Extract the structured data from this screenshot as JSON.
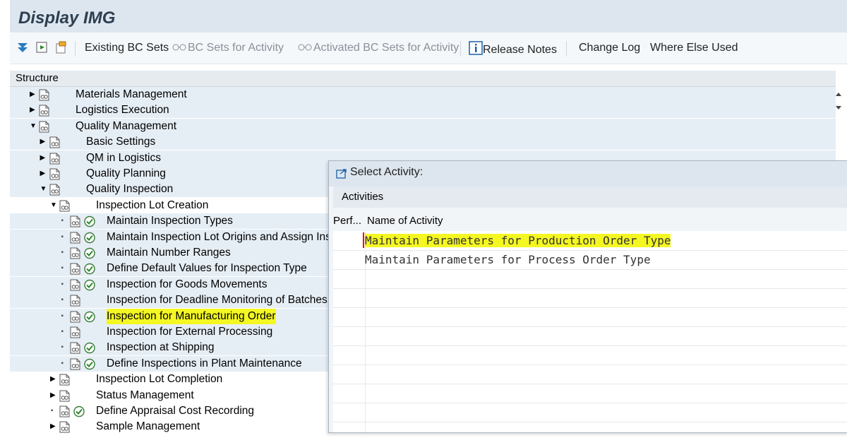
{
  "window": {
    "title": "Display IMG"
  },
  "toolbar": {
    "existing_bc_sets": "Existing BC Sets",
    "bc_sets_for_activity": "BC Sets for Activity",
    "activated_bc_sets": "Activated BC Sets for Activity",
    "release_notes": "Release Notes",
    "change_log": "Change Log",
    "where_else_used": "Where Else Used"
  },
  "structure": {
    "header": "Structure",
    "items": [
      {
        "label": "Materials Management"
      },
      {
        "label": "Logistics Execution"
      },
      {
        "label": "Quality Management"
      },
      {
        "label": "Basic Settings"
      },
      {
        "label": "QM in Logistics"
      },
      {
        "label": "Quality Planning"
      },
      {
        "label": "Quality Inspection"
      },
      {
        "label": "Inspection Lot Creation"
      },
      {
        "label": "Maintain Inspection Types"
      },
      {
        "label": "Maintain Inspection Lot Origins and Assign Ins"
      },
      {
        "label": "Maintain Number Ranges"
      },
      {
        "label": "Define Default Values for Inspection Type"
      },
      {
        "label": "Inspection for Goods Movements"
      },
      {
        "label": "Inspection for Deadline Monitoring of Batches"
      },
      {
        "label": "Inspection for Manufacturing Order"
      },
      {
        "label": "Inspection for External Processing"
      },
      {
        "label": "Inspection at Shipping"
      },
      {
        "label": "Define Inspections in Plant Maintenance"
      },
      {
        "label": "Inspection Lot Completion"
      },
      {
        "label": "Status Management"
      },
      {
        "label": "Define Appraisal Cost Recording"
      },
      {
        "label": "Sample Management"
      }
    ]
  },
  "dialog": {
    "title": "Select Activity:",
    "section": "Activities",
    "col_perf": "Perf...",
    "col_name": "Name of Activity",
    "activities": [
      {
        "name": "Maintain Parameters for Production Order Type"
      },
      {
        "name": "Maintain Parameters for Process Order Type"
      }
    ]
  },
  "colors": {
    "highlight": "#f4f722",
    "title_bar": "#dde6ee",
    "selected_row": "#e6eef5"
  }
}
